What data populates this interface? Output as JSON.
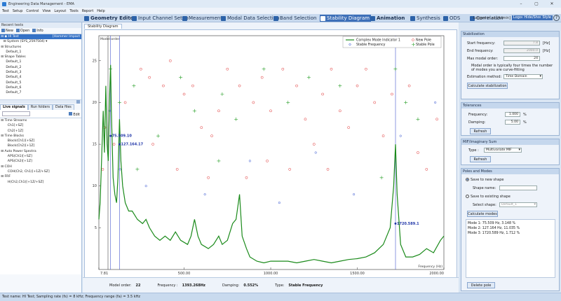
{
  "window": {
    "title": "Engineering Data Management - EMA"
  },
  "menu": [
    "Test",
    "Setup",
    "Control",
    "View",
    "Layout",
    "Tools",
    "Report",
    "Help"
  ],
  "toolbar": {
    "tabs": [
      {
        "label": "Geometry Editor",
        "bold": true
      },
      {
        "label": "Input Channel Setup"
      },
      {
        "label": "Measurement"
      },
      {
        "label": "Modal Data Selection"
      },
      {
        "label": "Band Selection"
      },
      {
        "label": "Stability Diagram",
        "active": true
      },
      {
        "label": "Animation",
        "bold": true
      },
      {
        "label": "Synthesis"
      },
      {
        "label": "ODS"
      },
      {
        "label": "Correlation"
      }
    ],
    "login_text": "Logged in as [Admin]",
    "logout": "Logout",
    "hideshow": "Hide/Show",
    "style": "Style",
    "help": "?"
  },
  "left": {
    "recent_tests": "Recent tests",
    "buttons": [
      "New",
      "Open",
      "Info"
    ],
    "tree": [
      {
        "text": "⊟ ◆ HI Test",
        "extra": "[Hammer Impact",
        "sel": true,
        "indent": 1
      },
      {
        "text": "⊟ System (SYS_2597504) ▾",
        "indent": 4
      },
      {
        "text": "⊟ Structures",
        "indent": 1
      },
      {
        "text": "Default_1",
        "indent": 7
      },
      {
        "text": "⊟ Shape Tables",
        "indent": 1
      },
      {
        "text": "Default_1",
        "indent": 7
      },
      {
        "text": "Default_2",
        "indent": 7
      },
      {
        "text": "Default_3",
        "indent": 7
      },
      {
        "text": "Default_4",
        "indent": 7
      },
      {
        "text": "Default_5",
        "indent": 7
      },
      {
        "text": "Default_6",
        "indent": 7
      },
      {
        "text": "Default_7",
        "indent": 7
      }
    ],
    "tabs": [
      "Live signals",
      "Run folders",
      "Data files"
    ],
    "edit": "Edit",
    "signals": [
      {
        "text": "⊟ Time Streams",
        "indent": 1
      },
      {
        "text": "Ch1[+SZ]",
        "indent": 9
      },
      {
        "text": "Ch2[+1Z]",
        "indent": 9
      },
      {
        "text": "⊟ Time Blocks",
        "indent": 1
      },
      {
        "text": "Block(Ch1)[+SZ]",
        "indent": 9
      },
      {
        "text": "Block(Ch2)[+1Z]",
        "indent": 9
      },
      {
        "text": "⊟ Auto Power Spectra",
        "indent": 1
      },
      {
        "text": "APS(Ch1)[+SZ]",
        "indent": 9
      },
      {
        "text": "APS(Ch2)[+1Z]",
        "indent": 9
      },
      {
        "text": "⊟ COH",
        "indent": 1
      },
      {
        "text": "COH(Ch2, Ch1)[+1Z/+SZ]",
        "indent": 9
      },
      {
        "text": "⊟ FRF",
        "indent": 1
      },
      {
        "text": "H(Ch2,Ch1)[+1Z/+SZ]",
        "indent": 9
      }
    ]
  },
  "plot": {
    "tab": "Stability Diagram",
    "model_order_label": "Model order",
    "freq_axis_label": "Frequency (Hz)",
    "legend": [
      "Complex Mode Indicator 1",
      "New Pole",
      "Stable Frequency",
      "Stable Pole"
    ],
    "colors": {
      "cmif": "#1a8a1a",
      "new": "#e03030",
      "freq": "#2f4fd0",
      "pole": "#2aa02a"
    },
    "annotations": [
      "75.509.10",
      "127.164.17",
      "1720.589.1"
    ],
    "bottom": {
      "model_order_label": "Model order:",
      "model_order": "22",
      "frequency_label": "Frequency :",
      "frequency": "1393.268Hz",
      "damping_label": "Damping:",
      "damping": "0.552%",
      "type_label": "Type:",
      "type": "Stable Frequency"
    }
  },
  "chart_data": {
    "type": "scatter",
    "x_ticks": [
      "7.81",
      "500.00",
      "1000.00",
      "1500.00",
      "2000.00"
    ],
    "y_ticks": [
      "25",
      "20",
      "15",
      "10",
      "5"
    ],
    "xlim": [
      7.81,
      2000
    ],
    "ylim": [
      0,
      28
    ],
    "cmif": [
      [
        7.81,
        6
      ],
      [
        15,
        8
      ],
      [
        25,
        14
      ],
      [
        33,
        19
      ],
      [
        40,
        14
      ],
      [
        48,
        22
      ],
      [
        55,
        15
      ],
      [
        62,
        13
      ],
      [
        70,
        21
      ],
      [
        75.5,
        24.5
      ],
      [
        80,
        19
      ],
      [
        90,
        11
      ],
      [
        100,
        9
      ],
      [
        110,
        8
      ],
      [
        118,
        11
      ],
      [
        127,
        18
      ],
      [
        135,
        13
      ],
      [
        145,
        10
      ],
      [
        160,
        8
      ],
      [
        180,
        7
      ],
      [
        200,
        7
      ],
      [
        230,
        6
      ],
      [
        260,
        5.5
      ],
      [
        280,
        6
      ],
      [
        300,
        5
      ],
      [
        330,
        4
      ],
      [
        360,
        3.5
      ],
      [
        390,
        4
      ],
      [
        420,
        3.5
      ],
      [
        450,
        4.5
      ],
      [
        480,
        3.5
      ],
      [
        520,
        3
      ],
      [
        540,
        4
      ],
      [
        560,
        6
      ],
      [
        580,
        4
      ],
      [
        600,
        3
      ],
      [
        640,
        2.5
      ],
      [
        670,
        3
      ],
      [
        700,
        4
      ],
      [
        720,
        3
      ],
      [
        750,
        3.5
      ],
      [
        780,
        5.5
      ],
      [
        800,
        6
      ],
      [
        820,
        9
      ],
      [
        835,
        4
      ],
      [
        860,
        2.5
      ],
      [
        880,
        1.5
      ],
      [
        920,
        1
      ],
      [
        960,
        0.8
      ],
      [
        1000,
        1
      ],
      [
        1050,
        1
      ],
      [
        1100,
        1
      ],
      [
        1150,
        0.8
      ],
      [
        1200,
        1
      ],
      [
        1250,
        1.2
      ],
      [
        1300,
        1
      ],
      [
        1350,
        0.8
      ],
      [
        1400,
        1
      ],
      [
        1450,
        1.2
      ],
      [
        1500,
        1.3
      ],
      [
        1550,
        1.5
      ],
      [
        1600,
        2
      ],
      [
        1650,
        3
      ],
      [
        1690,
        5
      ],
      [
        1710,
        10
      ],
      [
        1720.6,
        15
      ],
      [
        1730,
        9
      ],
      [
        1750,
        3
      ],
      [
        1780,
        1.5
      ],
      [
        1820,
        1.5
      ],
      [
        1860,
        1.8
      ],
      [
        1900,
        2.5
      ],
      [
        1940,
        2
      ],
      [
        1980,
        3.5
      ],
      [
        2000,
        4
      ]
    ],
    "stable_lines": [
      [
        75.5,
        20
      ],
      [
        127.2,
        18
      ],
      [
        1720.6,
        24
      ]
    ],
    "markers_new": [
      [
        30,
        12
      ],
      [
        42,
        17
      ],
      [
        95,
        15
      ],
      [
        160,
        20
      ],
      [
        250,
        24
      ],
      [
        300,
        23
      ],
      [
        380,
        22
      ],
      [
        420,
        25
      ],
      [
        500,
        21
      ],
      [
        550,
        22
      ],
      [
        600,
        17
      ],
      [
        660,
        16
      ],
      [
        700,
        19
      ],
      [
        750,
        24
      ],
      [
        820,
        22
      ],
      [
        900,
        20
      ],
      [
        950,
        23
      ],
      [
        1000,
        19
      ],
      [
        1070,
        24
      ],
      [
        1150,
        22
      ],
      [
        1200,
        18
      ],
      [
        1250,
        15
      ],
      [
        1300,
        21
      ],
      [
        1350,
        24
      ],
      [
        1400,
        19
      ],
      [
        1450,
        17
      ],
      [
        1500,
        22
      ],
      [
        1550,
        24
      ],
      [
        1600,
        20
      ],
      [
        1650,
        16
      ],
      [
        1700,
        21
      ],
      [
        1800,
        22
      ],
      [
        1850,
        14
      ],
      [
        1900,
        12
      ],
      [
        1960,
        18
      ],
      [
        320,
        15
      ],
      [
        460,
        12
      ],
      [
        640,
        11
      ],
      [
        860,
        11
      ],
      [
        980,
        13
      ],
      [
        1110,
        12
      ],
      [
        1330,
        12
      ]
    ],
    "markers_freq": [
      [
        70,
        19
      ],
      [
        130,
        12
      ],
      [
        280,
        10
      ],
      [
        620,
        9
      ],
      [
        1050,
        8
      ],
      [
        1480,
        9
      ],
      [
        1750,
        16
      ],
      [
        1950,
        20
      ],
      [
        880,
        13
      ],
      [
        1260,
        14
      ]
    ],
    "markers_pole": [
      [
        75,
        24
      ],
      [
        127,
        20
      ],
      [
        210,
        22
      ],
      [
        350,
        16
      ],
      [
        480,
        23
      ],
      [
        560,
        19
      ],
      [
        720,
        21
      ],
      [
        800,
        18
      ],
      [
        960,
        24
      ],
      [
        1100,
        20
      ],
      [
        1220,
        23
      ],
      [
        1400,
        22
      ],
      [
        1720,
        24
      ],
      [
        1780,
        20
      ],
      [
        1850,
        18
      ],
      [
        230,
        12
      ],
      [
        1640,
        11
      ],
      [
        700,
        13
      ]
    ]
  },
  "right": {
    "stabilization": {
      "title": "Stabilization",
      "start_label": "Start frequency:",
      "start_val": "7.8",
      "start_unit": "[Hz]",
      "end_label": "End frequency:",
      "end_val": "2000.0",
      "end_unit": "[Hz]",
      "max_label": "Max modal order:",
      "max_val": "24",
      "note": "Modal order is typically four times the number of modes you are curve-fitting",
      "method_label": "Estimation method:",
      "method_val": "Time Domain",
      "calc": "Calculate stabilization"
    },
    "tolerances": {
      "title": "Tolerances",
      "freq_label": "Frequency:",
      "freq_val": "1.000",
      "freq_unit": "%",
      "damp_label": "Damping:",
      "damp_val": "5.00",
      "damp_unit": "%",
      "refresh": "Refresh"
    },
    "mif": {
      "title": "MIF/Imaginary Sum",
      "type_label": "Type :",
      "type_val": "Multivariate MIF",
      "refresh": "Refresh"
    },
    "poles": {
      "title": "Poles and Modes",
      "save_new": "Save to new shape",
      "shape_name_label": "Shape name:",
      "save_existing": "Save to existing shape",
      "select_label": "Select shape:",
      "select_val": "Default_1",
      "calc": "Calculate modes",
      "modes": [
        "Mode 1: 75.509 Hz, 3.148 %",
        "Mode 2: 127.164 Hz, 11.035 %",
        "Mode 3: 1720.589 Hz, 1.712 %"
      ],
      "delete": "Delete pole"
    }
  },
  "status": "Test name: HI Test; Sampling rate (fs) = 8 kHz; Frequency range (fa) = 3.5 kHz"
}
